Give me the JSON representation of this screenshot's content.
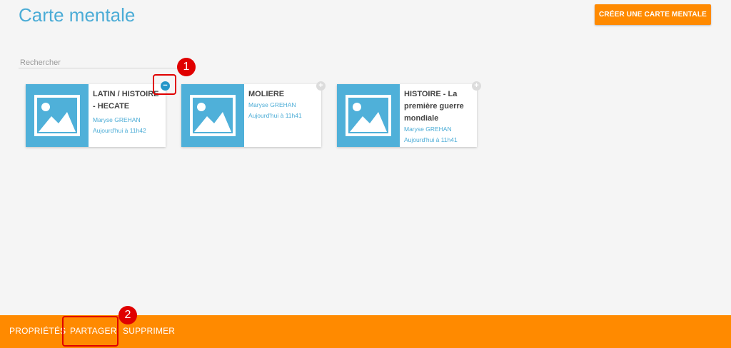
{
  "header": {
    "title": "Carte mentale",
    "create_label": "CRÉER UNE CARTE MENTALE"
  },
  "search": {
    "placeholder": "Rechercher",
    "value": ""
  },
  "cards": [
    {
      "title_lines": [
        "LATIN / HISTOIRE",
        "- HECATE"
      ],
      "author": "Maryse GREHAN",
      "date": "Aujourd'hui à 11h42",
      "toggle": "−",
      "selected": true
    },
    {
      "title_lines": [
        "MOLIERE"
      ],
      "author": "Maryse GREHAN",
      "date": "Aujourd'hui à 11h41",
      "toggle": "+",
      "selected": false
    },
    {
      "title_lines": [
        "HISTOIRE - La",
        "première guerre",
        "mondiale"
      ],
      "author": "Maryse GREHAN",
      "date": "Aujourd'hui à 11h41",
      "toggle": "+",
      "selected": false
    }
  ],
  "bottom_bar": {
    "properties_label": "PROPRIÉTÉS",
    "share_label": "PARTAGER",
    "delete_label": "SUPPRIMER"
  },
  "annotations": {
    "step1": "1",
    "step2": "2"
  },
  "colors": {
    "accent": "#ff8a00",
    "title_blue": "#4bacd6",
    "thumb_blue": "#4fb0d9",
    "callout_red": "#e00000"
  }
}
